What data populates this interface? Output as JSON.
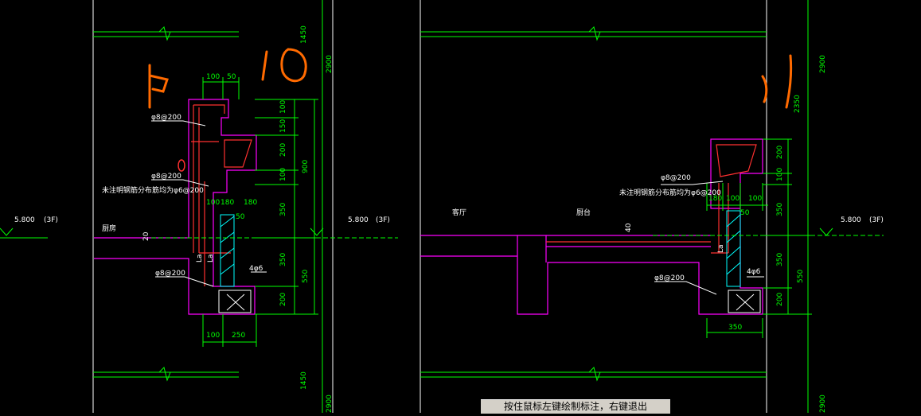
{
  "status_tip": "按住鼠标左键绘制标注，右键退出",
  "left_detail": {
    "top_dims": [
      "100",
      "50"
    ],
    "bottom_dims": [
      "100",
      "250"
    ],
    "mid_dims": [
      "100",
      "180",
      "50",
      "180"
    ],
    "right_dims": [
      "100",
      "150",
      "200",
      "100",
      "350",
      "350",
      "200"
    ],
    "outer_dims": [
      "900",
      "550"
    ],
    "rebar_labels": [
      "φ8@200",
      "φ8@200",
      "φ8@200"
    ],
    "note": "未注明钢筋分布筋均为φ6@200",
    "bars": "4φ6",
    "lap": [
      "La",
      "La"
    ],
    "room": "厨房",
    "slope_dim": "20",
    "elevation": "5.800",
    "floor": "(3F)"
  },
  "right_detail": {
    "top_dims": [
      "180",
      "100",
      "100"
    ],
    "mid_dim": "50",
    "bottom_dim": "350",
    "right_dims": [
      "200",
      "100",
      "350",
      "350",
      "200"
    ],
    "outer_dim": "550",
    "rebar_labels": [
      "φ8@200",
      "φ8@200"
    ],
    "note": "未注明钢筋分布筋均为φ6@200",
    "bars": "4φ6",
    "lap": "La",
    "rooms": [
      "客厅",
      "厨台"
    ],
    "slope_dim": "40",
    "elevation": "5.800",
    "floor": "(3F)"
  },
  "vertical_dims": [
    "1450",
    "2900",
    "1450",
    "2900",
    "2900",
    "2350",
    "2900"
  ],
  "left_edge_dims": [
    "5.800",
    "(3F)"
  ],
  "colors": {
    "background": "#000000",
    "grid_line": "#ffffff",
    "dimension": "#00ff00",
    "outline": "#ff00ff",
    "rebar": "#ff3030",
    "hatch": "#00ffff",
    "markup": "#ff6a00"
  }
}
